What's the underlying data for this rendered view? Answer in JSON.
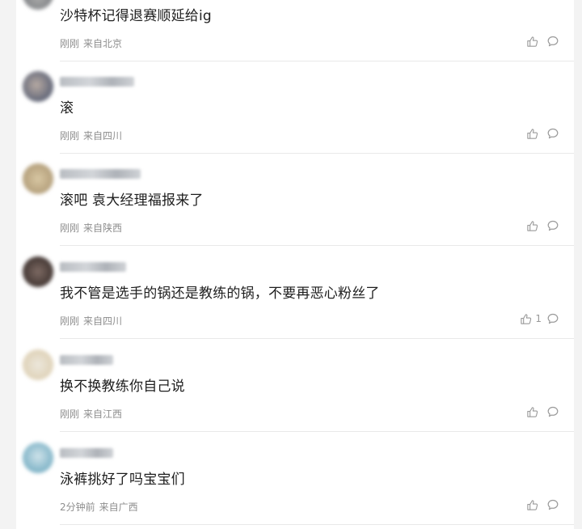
{
  "comments": [
    {
      "username": "",
      "text": "沙特杯记得退赛顺延给ig",
      "time": "刚刚",
      "location": "来自北京",
      "likes": "",
      "avatar_colors": [
        "#6b6f74",
        "#a9a9a9"
      ]
    },
    {
      "username": "",
      "text": "滚",
      "time": "刚刚",
      "location": "来自四川",
      "likes": "",
      "avatar_colors": [
        "#3d4a66",
        "#b7aaa3"
      ]
    },
    {
      "username": "",
      "text": "滚吧 袁大经理福报来了",
      "time": "刚刚",
      "location": "来自陕西",
      "likes": "",
      "avatar_colors": [
        "#d8c7a3",
        "#a58f6b"
      ]
    },
    {
      "username": "",
      "text": "我不管是选手的锅还是教练的锅，不要再恶心粉丝了",
      "time": "刚刚",
      "location": "来自四川",
      "likes": "1",
      "avatar_colors": [
        "#2b2220",
        "#7d6a63"
      ]
    },
    {
      "username": "",
      "text": "换不换教练你自己说",
      "time": "刚刚",
      "location": "来自江西",
      "likes": "",
      "avatar_colors": [
        "#ece7dc",
        "#d9c9a8"
      ]
    },
    {
      "username": "",
      "text": "泳裤挑好了吗宝宝们",
      "time": "2分钟前",
      "location": "来自广西",
      "likes": "",
      "avatar_colors": [
        "#5d9fb8",
        "#cfe3ea"
      ]
    }
  ],
  "icons": {
    "like": "thumbs-up-icon",
    "reply": "comment-bubble-icon"
  },
  "colors": {
    "text": "#1e1e1e",
    "meta": "#8e8e8e",
    "icon": "#9a9a9a",
    "divider": "#e9e9e9"
  }
}
